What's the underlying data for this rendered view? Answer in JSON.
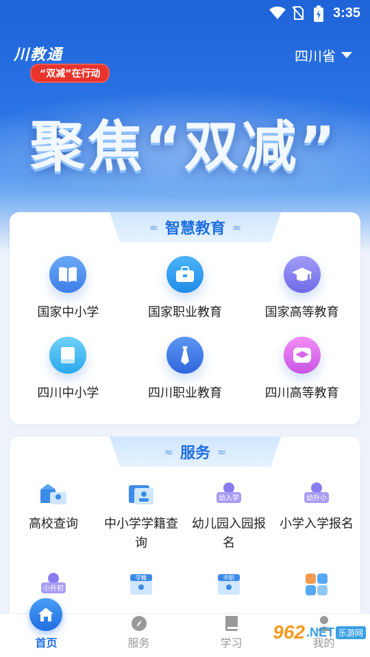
{
  "status_bar": {
    "time": "3:35",
    "icons": [
      "wifi-icon",
      "no-sim-icon",
      "battery-icon"
    ]
  },
  "header": {
    "app_logo": "川教通",
    "tagline": "“双减”在行动",
    "province": "四川省",
    "banner": "聚焦“双减”"
  },
  "smart_education": {
    "title": "智慧教育",
    "items": [
      {
        "label": "国家中小学",
        "icon": "book-open-icon",
        "color": "#3f8cf0"
      },
      {
        "label": "国家职业教育",
        "icon": "briefcase-icon",
        "color": "#2b9cf0"
      },
      {
        "label": "国家高等教育",
        "icon": "graduation-cap-icon",
        "color": "#7d7bf0"
      },
      {
        "label": "四川中小学",
        "icon": "book-icon",
        "color": "#37b0f2"
      },
      {
        "label": "四川职业教育",
        "icon": "tie-icon",
        "color": "#3e7fee"
      },
      {
        "label": "四川高等教育",
        "icon": "graduation-cap-icon",
        "color": "#e06bea"
      }
    ]
  },
  "services": {
    "title": "服务",
    "items": [
      {
        "label": "高校查询",
        "icon": "university-search-icon"
      },
      {
        "label": "中小学学籍查询",
        "icon": "student-record-icon"
      },
      {
        "label": "幼儿园入园报名",
        "icon": "kindergarten-enroll-icon",
        "badge": "幼入学"
      },
      {
        "label": "小学入学报名",
        "icon": "primary-enroll-icon",
        "badge": "幼升小"
      },
      {
        "label": "",
        "icon": "middle-school-enroll-icon",
        "badge": "小升初"
      },
      {
        "label": "",
        "icon": "academic-record-icon",
        "badge": "学籍"
      },
      {
        "label": "",
        "icon": "vocational-icon",
        "badge": "中职"
      },
      {
        "label": "",
        "icon": "more-apps-icon"
      }
    ]
  },
  "tabbar": {
    "tabs": [
      {
        "label": "首页",
        "icon": "home-icon",
        "active": true
      },
      {
        "label": "服务",
        "icon": "compass-icon",
        "active": false
      },
      {
        "label": "学习",
        "icon": "book-icon",
        "active": false
      },
      {
        "label": "我的",
        "icon": "user-icon",
        "active": false
      }
    ]
  },
  "watermark": {
    "number": "962",
    "suffix": ".NET",
    "site": "乐游网"
  }
}
